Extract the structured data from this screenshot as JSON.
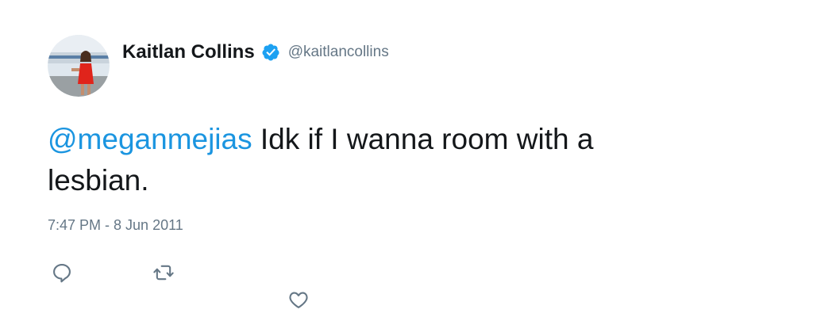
{
  "tweet": {
    "display_name": "Kaitlan Collins",
    "handle": "@kaitlancollins",
    "verified": true,
    "mention": "@meganmejias",
    "text_line1": " Idk if I wanna room with a",
    "text_line2": "lesbian.",
    "timestamp": "7:47 PM - 8 Jun 2011"
  },
  "icons": {
    "verified": "verified-badge-icon",
    "reply": "reply-icon",
    "retweet": "retweet-icon",
    "like": "heart-icon"
  },
  "colors": {
    "text": "#14171a",
    "secondary": "#657786",
    "link": "#1b95e0",
    "verified_badge": "#1da1f2"
  }
}
